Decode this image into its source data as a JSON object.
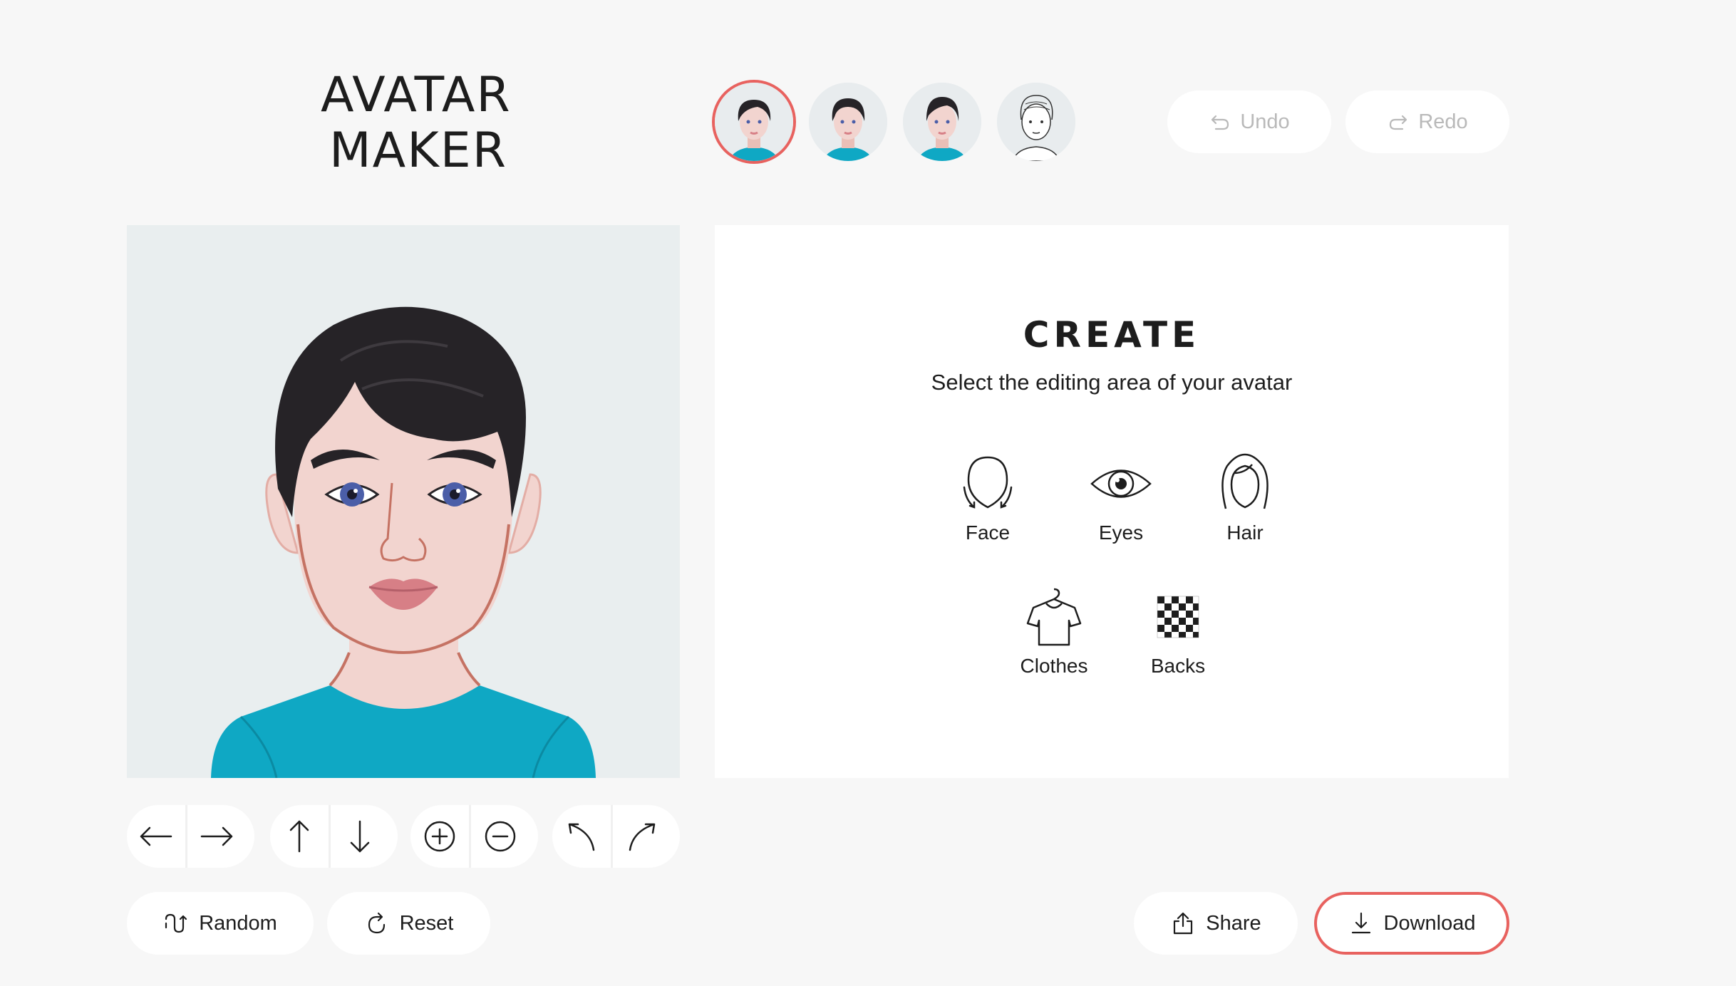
{
  "logo": {
    "line1": "AVATAR",
    "line2": "MAKER"
  },
  "presets": [
    {
      "name": "Preset avatar 1",
      "selected": true
    },
    {
      "name": "Preset avatar 2",
      "selected": false
    },
    {
      "name": "Preset avatar 3",
      "selected": false
    },
    {
      "name": "Preset avatar 4",
      "selected": false
    }
  ],
  "history": {
    "undo_label": "Undo",
    "redo_label": "Redo",
    "undo_icon": "undo-icon",
    "redo_icon": "redo-icon"
  },
  "panel": {
    "title": "CREATE",
    "subtitle": "Select the editing area of your avatar",
    "options": [
      {
        "label": "Face",
        "icon": "face-icon"
      },
      {
        "label": "Eyes",
        "icon": "eye-icon"
      },
      {
        "label": "Hair",
        "icon": "hair-icon"
      },
      {
        "label": "Clothes",
        "icon": "shirt-icon"
      },
      {
        "label": "Backs",
        "icon": "checkerboard-icon"
      }
    ]
  },
  "controls": {
    "move": [
      "arrow-left-icon",
      "arrow-right-icon"
    ],
    "vertical": [
      "arrow-up-icon",
      "arrow-down-icon"
    ],
    "zoom": [
      "zoom-in-icon",
      "zoom-out-icon"
    ],
    "rotate": [
      "rotate-left-icon",
      "rotate-right-icon"
    ]
  },
  "actions": {
    "random_label": "Random",
    "reset_label": "Reset",
    "share_label": "Share",
    "download_label": "Download"
  },
  "colors": {
    "accent": "#e8625f",
    "background": "#f7f7f7",
    "canvas_bg": "#e9eeef",
    "skin": "#f2d4cf",
    "hair": "#262327",
    "shirt": "#0fa8c4",
    "lips": "#d77f86",
    "iris": "#4b5ea8"
  }
}
